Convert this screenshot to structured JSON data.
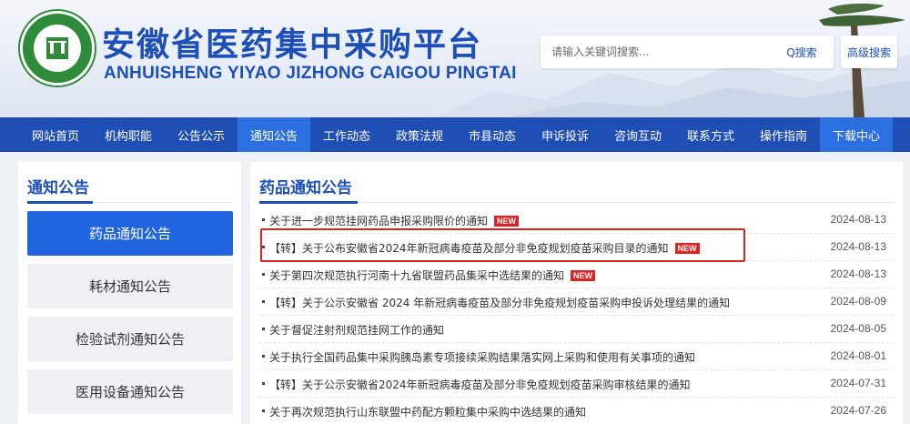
{
  "header": {
    "title_cn": "安徽省医药集中采购平台",
    "title_en": "ANHUISHENG YIYAO JIZHONG CAIGOU PINGTAI",
    "search_placeholder": "请输入关键词搜索...",
    "search_label": "Q搜索",
    "advanced_search_label": "高级搜索"
  },
  "nav": {
    "items": [
      {
        "label": "网站首页"
      },
      {
        "label": "机构职能"
      },
      {
        "label": "公告公示"
      },
      {
        "label": "通知公告",
        "active": true
      },
      {
        "label": "工作动态"
      },
      {
        "label": "政策法规"
      },
      {
        "label": "市县动态"
      },
      {
        "label": "申诉投诉"
      },
      {
        "label": "咨询互动"
      },
      {
        "label": "联系方式"
      },
      {
        "label": "操作指南"
      },
      {
        "label": "下载中心"
      }
    ]
  },
  "sidebar": {
    "title": "通知公告",
    "items": [
      {
        "label": "药品通知公告",
        "active": true
      },
      {
        "label": "耗材通知公告"
      },
      {
        "label": "检验试剂通知公告"
      },
      {
        "label": "医用设备通知公告"
      }
    ]
  },
  "main": {
    "title": "药品通知公告",
    "new_badge": "NEW",
    "rows": [
      {
        "title": "关于进一步规范挂网药品申报采购限价的通知",
        "date": "2024-08-13",
        "is_new": true
      },
      {
        "title": "【转】关于公布安徽省2024年新冠病毒疫苗及部分非免疫规划疫苗采购目录的通知",
        "date": "2024-08-13",
        "is_new": true,
        "highlighted": true
      },
      {
        "title": "关于第四次规范执行河南十九省联盟药品集采中选结果的通知",
        "date": "2024-08-13",
        "is_new": true
      },
      {
        "title": "【转】关于公示安徽省 2024 年新冠病毒疫苗及部分非免疫规划疫苗采购申投诉处理结果的通知",
        "date": "2024-08-09",
        "is_new": false
      },
      {
        "title": "关于督促注射剂规范挂网工作的通知",
        "date": "2024-08-05",
        "is_new": false
      },
      {
        "title": "关于执行全国药品集中采购胰岛素专项接续采购结果落实网上采购和使用有关事项的通知",
        "date": "2024-08-01",
        "is_new": false
      },
      {
        "title": "【转】关于公示安徽省2024年新冠病毒疫苗及部分非免疫规划疫苗采购审核结果的通知",
        "date": "2024-07-31",
        "is_new": false
      },
      {
        "title": "关于再次规范执行山东联盟中药配方颗粒集中采购中选结果的通知",
        "date": "2024-07-26",
        "is_new": false
      }
    ]
  },
  "colors": {
    "brand_blue": "#1f4fb5",
    "active_blue": "#2c6fe0",
    "new_red": "#e02222",
    "logo_green": "#2e8b3a"
  }
}
